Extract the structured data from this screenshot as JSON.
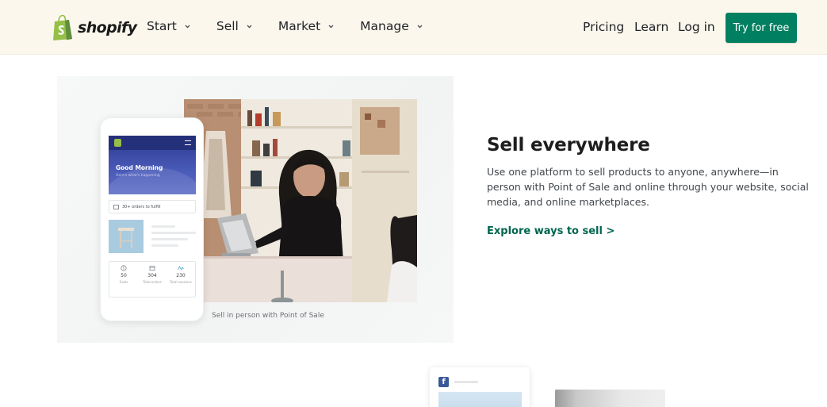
{
  "brand": {
    "name": "shopify",
    "logo_color": "#95bf47",
    "accent": "#008060"
  },
  "nav": {
    "items": [
      {
        "label": "Start",
        "icon": "chevron-down-icon"
      },
      {
        "label": "Sell",
        "icon": "chevron-down-icon"
      },
      {
        "label": "Market",
        "icon": "chevron-down-icon"
      },
      {
        "label": "Manage",
        "icon": "chevron-down-icon"
      }
    ],
    "pricing": "Pricing",
    "learn": "Learn",
    "login": "Log in",
    "cta": "Try for free"
  },
  "illustration": {
    "phone": {
      "greeting": "Good Morning",
      "subtitle": "Here's what's happening",
      "orders_text": "30+ orders to fulfill",
      "stats": [
        {
          "value": "50",
          "label": "Sales",
          "icon": "dollar-icon"
        },
        {
          "value": "304",
          "label": "Total orders",
          "icon": "orders-icon"
        },
        {
          "value": "230",
          "label": "Total sessions",
          "icon": "activity-icon"
        }
      ]
    },
    "caption": "Sell in person with Point of Sale"
  },
  "section": {
    "title": "Sell everywhere",
    "description_lines": [
      "Use one platform to sell products to anyone, anywhere—in",
      "person with Point of Sale and online through your website, social",
      "media, and online marketplaces."
    ],
    "link": "Explore ways to sell >"
  },
  "bottom": {
    "facebook_letter": "f"
  }
}
